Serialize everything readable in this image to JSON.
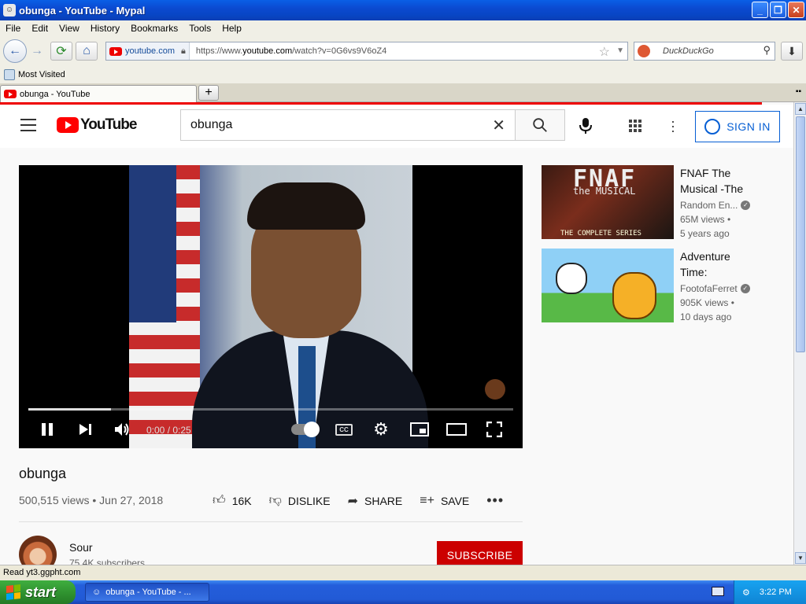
{
  "window": {
    "title": "obunga - YouTube - Mypal"
  },
  "menu": [
    "File",
    "Edit",
    "View",
    "History",
    "Bookmarks",
    "Tools",
    "Help"
  ],
  "nav": {
    "site_chip": "youtube.com",
    "url_prefix": "https://www.",
    "url_host": "youtube.com",
    "url_path": "/watch?v=0G6vs9V6oZ4",
    "search_placeholder": "DuckDuckGo"
  },
  "bookmarks": {
    "most_visited": "Most Visited"
  },
  "tabs": [
    {
      "label": "obunga - YouTube"
    }
  ],
  "youtube": {
    "logo_text": "YouTube",
    "search_value": "obunga",
    "sign_in": "SIGN IN",
    "player": {
      "time": "0:00 / 0:25",
      "progress_fraction": 0.17,
      "cc_label": "CC"
    },
    "video": {
      "title": "obunga",
      "meta": "500,515 views • Jun 27, 2018",
      "likes": "16K",
      "dislike": "DISLIKE",
      "share": "SHARE",
      "save": "SAVE"
    },
    "channel": {
      "name": "Sour",
      "subscribers": "75.4K subscribers",
      "subscribe": "SUBSCRIBE"
    },
    "recommendations": [
      {
        "title_line1": "FNAF The",
        "title_line2": "Musical -The",
        "channel": "Random En...",
        "views": "65M views •",
        "age": "5 years ago",
        "thumb_text_1": "FNAF",
        "thumb_text_2": "the MUSICAL",
        "thumb_text_3": "THE COMPLETE SERIES"
      },
      {
        "title_line1": "Adventure",
        "title_line2": "Time:",
        "channel": "FootofaFerret",
        "views": "905K views •",
        "age": "10 days ago"
      }
    ]
  },
  "status": {
    "text": "Read yt3.ggpht.com"
  },
  "taskbar": {
    "start": "start",
    "item": "obunga - YouTube - ...",
    "clock": "3:22 PM"
  },
  "colors": {
    "youtube_red": "#ff0000",
    "subscribe_red": "#cc0000",
    "signin_blue": "#065fd4",
    "xp_taskbar": "#245edb",
    "xp_start_green": "#2e8f2e"
  }
}
